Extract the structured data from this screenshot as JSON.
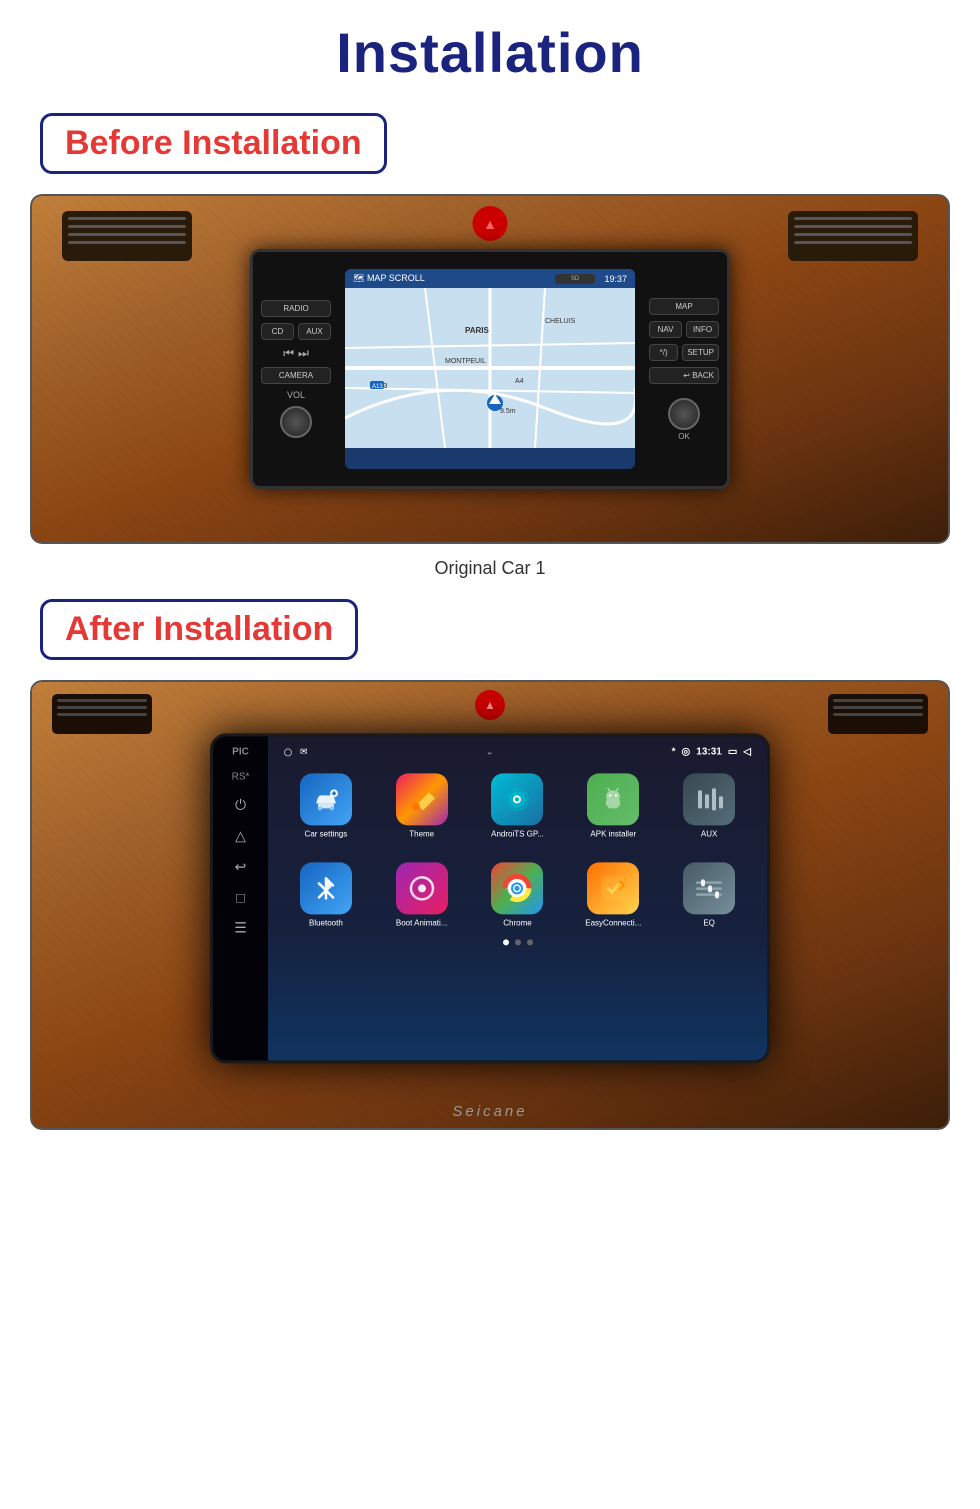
{
  "page": {
    "title": "Installation",
    "background_color": "#ffffff"
  },
  "sections": {
    "main_title": "Installation",
    "before_label": "Before Installation",
    "after_label": "After Installation",
    "original_car_caption": "Original Car  1",
    "seicane_brand": "Seicane"
  },
  "before_screen": {
    "map_label": "MAP SCROLL",
    "time": "19:37",
    "buttons": {
      "radio": "RADIO",
      "cd": "CD",
      "aux": "AUX",
      "camera": "CAMERA",
      "map": "MAP",
      "nav": "NAV",
      "info": "INFO",
      "setup": "SETUP",
      "back": "BACK",
      "ok": "OK",
      "vol": "VOL",
      "sd": "SD"
    }
  },
  "after_screen": {
    "time": "13:31",
    "status_icons": [
      "*",
      "◎"
    ],
    "apps": [
      {
        "name": "Car settings",
        "icon": "⚙",
        "color_class": "app-car-settings"
      },
      {
        "name": "Theme",
        "icon": "🎨",
        "color_class": "app-theme"
      },
      {
        "name": "AndroiTS GP...",
        "icon": "◉",
        "color_class": "app-androids"
      },
      {
        "name": "APK installer",
        "icon": "🤖",
        "color_class": "app-apk"
      },
      {
        "name": "AUX",
        "icon": "▐▐▐",
        "color_class": "app-aux"
      },
      {
        "name": "Bluetooth",
        "icon": "₿",
        "color_class": "app-bluetooth"
      },
      {
        "name": "Boot Animati...",
        "icon": "⏻",
        "color_class": "app-boot"
      },
      {
        "name": "Chrome",
        "icon": "◎",
        "color_class": "app-chrome"
      },
      {
        "name": "EasyConnecti...",
        "icon": "⊡",
        "color_class": "app-easyconnect"
      },
      {
        "name": "EQ",
        "icon": "≡",
        "color_class": "app-eq"
      }
    ],
    "dots": [
      true,
      false,
      false
    ],
    "side_icons": [
      "⏻",
      "△",
      "↩",
      "□",
      "☰"
    ]
  }
}
